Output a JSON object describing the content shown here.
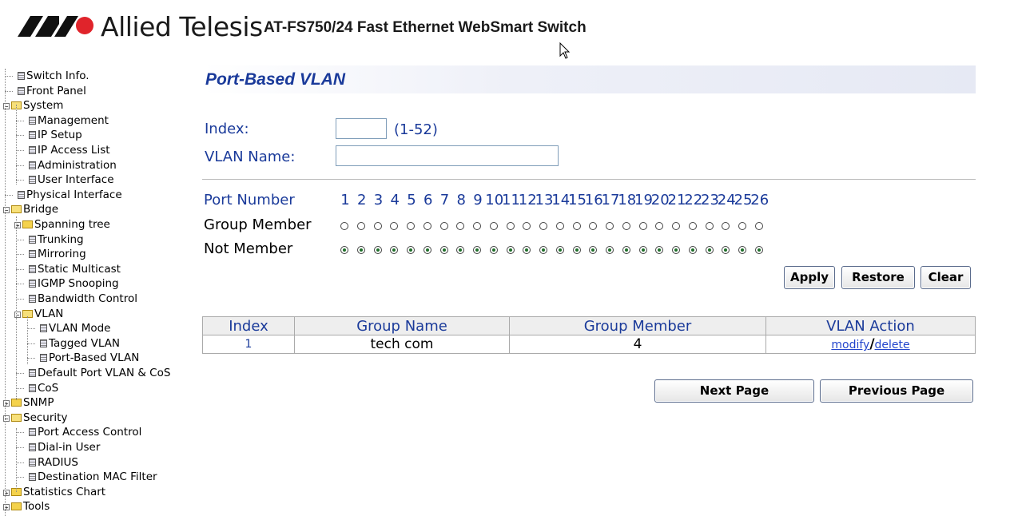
{
  "header": {
    "brand": "Allied Telesis",
    "product": "AT-FS750/24 Fast Ethernet WebSmart Switch"
  },
  "sidebar": {
    "items": [
      {
        "label": "Switch Info.",
        "type": "doc"
      },
      {
        "label": "Front Panel",
        "type": "doc"
      },
      {
        "label": "System",
        "type": "folder",
        "expanded": true
      },
      {
        "label": "Management",
        "type": "doc"
      },
      {
        "label": "IP Setup",
        "type": "doc"
      },
      {
        "label": "IP Access List",
        "type": "doc"
      },
      {
        "label": "Administration",
        "type": "doc"
      },
      {
        "label": "User Interface",
        "type": "doc"
      },
      {
        "label": "Physical Interface",
        "type": "doc"
      },
      {
        "label": "Bridge",
        "type": "folder",
        "expanded": true
      },
      {
        "label": "Spanning tree",
        "type": "folder",
        "expanded": false
      },
      {
        "label": "Trunking",
        "type": "doc"
      },
      {
        "label": "Mirroring",
        "type": "doc"
      },
      {
        "label": "Static Multicast",
        "type": "doc"
      },
      {
        "label": "IGMP Snooping",
        "type": "doc"
      },
      {
        "label": "Bandwidth Control",
        "type": "doc"
      },
      {
        "label": "VLAN",
        "type": "folder",
        "expanded": true
      },
      {
        "label": "VLAN Mode",
        "type": "doc"
      },
      {
        "label": "Tagged VLAN",
        "type": "doc"
      },
      {
        "label": "Port-Based VLAN",
        "type": "doc"
      },
      {
        "label": "Default Port VLAN & CoS",
        "type": "doc"
      },
      {
        "label": "CoS",
        "type": "doc"
      },
      {
        "label": "SNMP",
        "type": "folder",
        "expanded": false
      },
      {
        "label": "Security",
        "type": "folder",
        "expanded": true
      },
      {
        "label": "Port Access Control",
        "type": "doc"
      },
      {
        "label": "Dial-in User",
        "type": "doc"
      },
      {
        "label": "RADIUS",
        "type": "doc"
      },
      {
        "label": "Destination MAC Filter",
        "type": "doc"
      },
      {
        "label": "Statistics Chart",
        "type": "folder",
        "expanded": false
      },
      {
        "label": "Tools",
        "type": "folder",
        "expanded": false
      }
    ]
  },
  "main": {
    "title": "Port-Based VLAN",
    "form": {
      "index_label": "Index:",
      "index_value": "",
      "index_range": "(1-52)",
      "vlan_name_label": "VLAN Name:",
      "vlan_name_value": ""
    },
    "ports": {
      "port_number_label": "Port Number",
      "group_member_label": "Group Member",
      "not_member_label": "Not Member",
      "numbers": [
        "1",
        "2",
        "3",
        "4",
        "5",
        "6",
        "7",
        "8",
        "9",
        "10",
        "11",
        "12",
        "13",
        "14",
        "15",
        "16",
        "17",
        "18",
        "19",
        "20",
        "21",
        "22",
        "23",
        "24",
        "25",
        "26"
      ],
      "selection": "not_member"
    },
    "buttons": {
      "apply": "Apply",
      "restore": "Restore",
      "clear": "Clear",
      "next_page": "Next Page",
      "previous_page": "Previous Page"
    },
    "table": {
      "headers": [
        "Index",
        "Group Name",
        "Group Member",
        "VLAN Action"
      ],
      "rows": [
        {
          "index": "1",
          "group_name": "tech com",
          "group_member": "4",
          "modify": "modify",
          "separator": "/",
          "delete": "delete"
        }
      ]
    }
  }
}
